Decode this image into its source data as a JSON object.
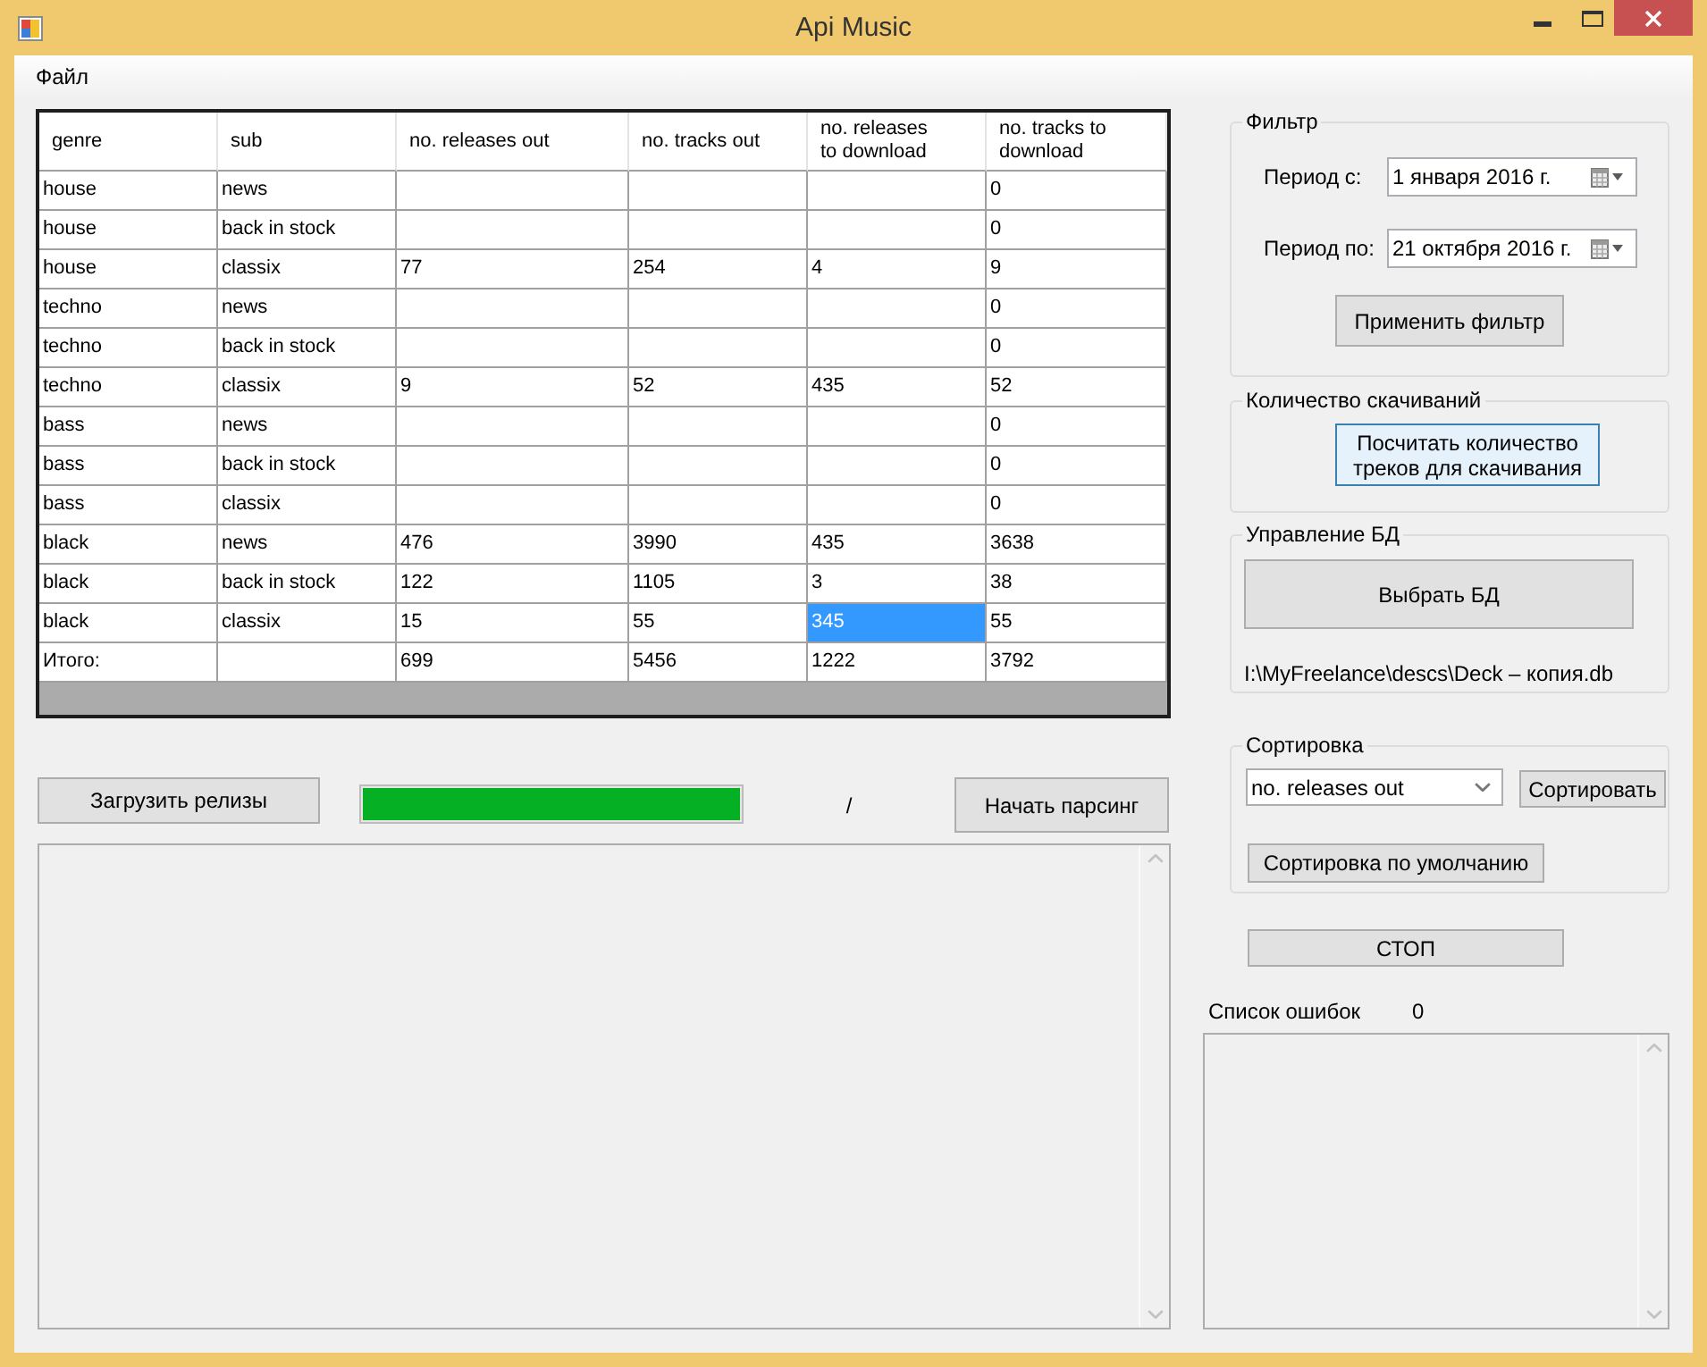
{
  "window": {
    "title": "Api Music"
  },
  "menu": [
    {
      "label": "Файл"
    }
  ],
  "table": {
    "columns": [
      "genre",
      "sub",
      "no. releases out",
      "no. tracks out",
      "no. releases to download",
      "no. tracks to download"
    ],
    "rows": [
      {
        "cells": [
          {
            "text": "house",
            "selected": false
          },
          {
            "text": "news",
            "selected": false
          },
          {
            "selected": false
          },
          {
            "selected": false
          },
          {
            "selected": false
          },
          {
            "text": "0",
            "selected": false
          }
        ]
      },
      {
        "cells": [
          {
            "text": "house",
            "selected": false
          },
          {
            "text": "back in stock",
            "selected": false
          },
          {
            "selected": false
          },
          {
            "selected": false
          },
          {
            "selected": false
          },
          {
            "text": "0",
            "selected": false
          }
        ]
      },
      {
        "cells": [
          {
            "text": "house",
            "selected": false
          },
          {
            "text": "classix",
            "selected": false
          },
          {
            "text": "77",
            "selected": false
          },
          {
            "text": "254",
            "selected": false
          },
          {
            "text": "4",
            "selected": false
          },
          {
            "text": "9",
            "selected": false
          }
        ]
      },
      {
        "cells": [
          {
            "text": "techno",
            "selected": false
          },
          {
            "text": "news",
            "selected": false
          },
          {
            "selected": false
          },
          {
            "selected": false
          },
          {
            "selected": false
          },
          {
            "text": "0",
            "selected": false
          }
        ]
      },
      {
        "cells": [
          {
            "text": "techno",
            "selected": false
          },
          {
            "text": "back in stock",
            "selected": false
          },
          {
            "selected": false
          },
          {
            "selected": false
          },
          {
            "selected": false
          },
          {
            "text": "0",
            "selected": false
          }
        ]
      },
      {
        "cells": [
          {
            "text": "techno",
            "selected": false
          },
          {
            "text": "classix",
            "selected": false
          },
          {
            "text": "9",
            "selected": false
          },
          {
            "text": "52",
            "selected": false
          },
          {
            "text": "435",
            "selected": false
          },
          {
            "text": "52",
            "selected": false
          }
        ]
      },
      {
        "cells": [
          {
            "text": "bass",
            "selected": false
          },
          {
            "text": "news",
            "selected": false
          },
          {
            "selected": false
          },
          {
            "selected": false
          },
          {
            "selected": false
          },
          {
            "text": "0",
            "selected": false
          }
        ]
      },
      {
        "cells": [
          {
            "text": "bass",
            "selected": false
          },
          {
            "text": "back in stock",
            "selected": false
          },
          {
            "selected": false
          },
          {
            "selected": false
          },
          {
            "selected": false
          },
          {
            "text": "0",
            "selected": false
          }
        ]
      },
      {
        "cells": [
          {
            "text": "bass",
            "selected": false
          },
          {
            "text": "classix",
            "selected": false
          },
          {
            "selected": false
          },
          {
            "selected": false
          },
          {
            "selected": false
          },
          {
            "text": "0",
            "selected": false
          }
        ]
      },
      {
        "cells": [
          {
            "text": "black",
            "selected": false
          },
          {
            "text": "news",
            "selected": false
          },
          {
            "text": "476",
            "selected": false
          },
          {
            "text": "3990",
            "selected": false
          },
          {
            "text": "435",
            "selected": false
          },
          {
            "text": "3638",
            "selected": false
          }
        ]
      },
      {
        "cells": [
          {
            "text": "black",
            "selected": false
          },
          {
            "text": "back in stock",
            "selected": false
          },
          {
            "text": "122",
            "selected": false
          },
          {
            "text": "1105",
            "selected": false
          },
          {
            "text": "3",
            "selected": false
          },
          {
            "text": "38",
            "selected": false
          }
        ]
      },
      {
        "cells": [
          {
            "text": "black",
            "selected": false
          },
          {
            "text": "classix",
            "selected": false
          },
          {
            "text": "15",
            "selected": false
          },
          {
            "text": "55",
            "selected": false
          },
          {
            "text": "345",
            "selected": true
          },
          {
            "text": "55",
            "selected": false
          }
        ]
      },
      {
        "cells": [
          {
            "text": "Итого:",
            "selected": false
          },
          {
            "selected": false
          },
          {
            "text": "699",
            "selected": false
          },
          {
            "text": "5456",
            "selected": false
          },
          {
            "text": "1222",
            "selected": false
          },
          {
            "text": "3792",
            "selected": false
          }
        ]
      }
    ]
  },
  "load_button": "Загрузить релизы",
  "progress": {
    "level": 1,
    "text": "/"
  },
  "parse_button": "Начать парсинг",
  "filter": {
    "title": "Фильтр",
    "fields": [
      {
        "label": "Период с:",
        "value": "1 января 2016 г."
      },
      {
        "label": "Период по:",
        "value": "21 октября 2016 г."
      }
    ],
    "button": "Применить фильтр"
  },
  "downloads": {
    "title": "Количество скачиваний",
    "button": "Посчитать количество треков для скачивания",
    "focused": true
  },
  "database": {
    "title": "Управление БД",
    "button": "Выбрать БД",
    "path": "I:\\MyFreelance\\descs\\Deck – копия.db"
  },
  "sort": {
    "title": "Сортировка",
    "dropdown": {
      "value": "no. releases out"
    },
    "button": "Сортировать",
    "default_button": "Сортировка по умолчанию"
  },
  "stop_button": "СТОП",
  "errors": {
    "label": "Список ошибок",
    "count": "0"
  }
}
